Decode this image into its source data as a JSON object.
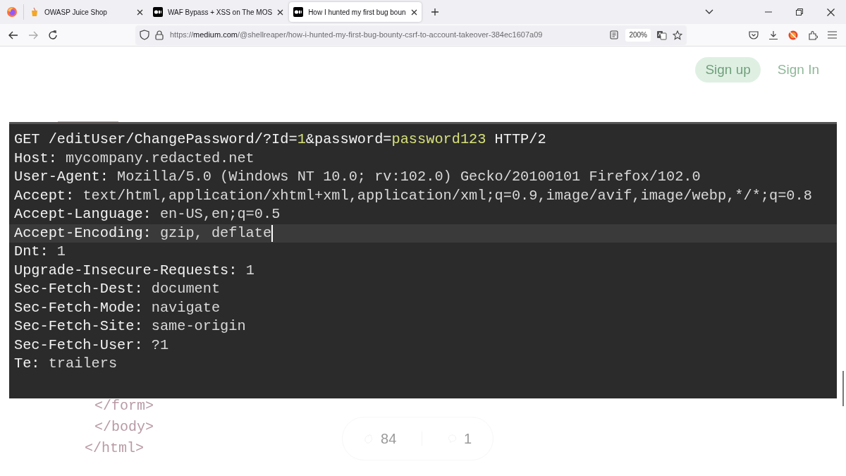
{
  "tabs": [
    {
      "title": "OWASP Juice Shop",
      "kind": "shop",
      "selected": false
    },
    {
      "title": "WAF Bypass + XSS on The MOS",
      "kind": "article",
      "selected": false
    },
    {
      "title": "How I hunted my first bug boun",
      "kind": "article",
      "selected": true
    }
  ],
  "address_bar": {
    "scheme": "https://",
    "host": "medium.com",
    "path": "/@shellreaper/how-i-hunted-my-first-bug-bounty-csrf-to-account-takeover-384ec1607a09",
    "zoom": "200%"
  },
  "page": {
    "sign_up": "Sign up",
    "sign_in": "Sign In",
    "code_lines": [
      {
        "current": false,
        "segments": [
          {
            "kind": "plain",
            "text": "GET /editUser/ChangePassword/?Id="
          },
          {
            "kind": "param",
            "text": "1"
          },
          {
            "kind": "plain",
            "text": "&password="
          },
          {
            "kind": "param",
            "text": "password123"
          },
          {
            "kind": "plain",
            "text": " HTTP/2"
          }
        ]
      },
      {
        "current": false,
        "segments": [
          {
            "kind": "plain",
            "text": "Host: "
          },
          {
            "kind": "value",
            "text": "mycompany.redacted.net"
          }
        ]
      },
      {
        "current": false,
        "segments": [
          {
            "kind": "plain",
            "text": "User-Agent: "
          },
          {
            "kind": "value",
            "text": "Mozilla/5.0 (Windows NT 10.0; rv:102.0) Gecko/20100101 Firefox/102.0"
          }
        ]
      },
      {
        "current": false,
        "segments": [
          {
            "kind": "plain",
            "text": "Accept: "
          },
          {
            "kind": "value",
            "text": "text/html,application/xhtml+xml,application/xml;q=0.9,image/avif,image/webp,*/*;q=0.8"
          }
        ]
      },
      {
        "current": false,
        "segments": [
          {
            "kind": "plain",
            "text": "Accept-Language: "
          },
          {
            "kind": "value",
            "text": "en-US,en;q=0.5"
          }
        ]
      },
      {
        "current": true,
        "segments": [
          {
            "kind": "plain",
            "text": "Accept-Encoding: "
          },
          {
            "kind": "value",
            "text": "gzip, deflate"
          }
        ]
      },
      {
        "current": false,
        "segments": [
          {
            "kind": "plain",
            "text": "Dnt: "
          },
          {
            "kind": "value",
            "text": "1"
          }
        ]
      },
      {
        "current": false,
        "segments": [
          {
            "kind": "plain",
            "text": "Upgrade-Insecure-Requests: "
          },
          {
            "kind": "value",
            "text": "1"
          }
        ]
      },
      {
        "current": false,
        "segments": [
          {
            "kind": "plain",
            "text": "Sec-Fetch-Dest: "
          },
          {
            "kind": "value",
            "text": "document"
          }
        ]
      },
      {
        "current": false,
        "segments": [
          {
            "kind": "plain",
            "text": "Sec-Fetch-Mode: "
          },
          {
            "kind": "value",
            "text": "navigate"
          }
        ]
      },
      {
        "current": false,
        "segments": [
          {
            "kind": "plain",
            "text": "Sec-Fetch-Site: "
          },
          {
            "kind": "value",
            "text": "same-origin"
          }
        ]
      },
      {
        "current": false,
        "segments": [
          {
            "kind": "plain",
            "text": "Sec-Fetch-User: "
          },
          {
            "kind": "value",
            "text": "?1"
          }
        ]
      },
      {
        "current": false,
        "segments": [
          {
            "kind": "plain",
            "text": "Te: "
          },
          {
            "kind": "value",
            "text": "trailers"
          }
        ]
      }
    ],
    "faded_code": [
      "</form>",
      "</body>",
      "</html>"
    ],
    "claps": "84",
    "responses": "1"
  }
}
